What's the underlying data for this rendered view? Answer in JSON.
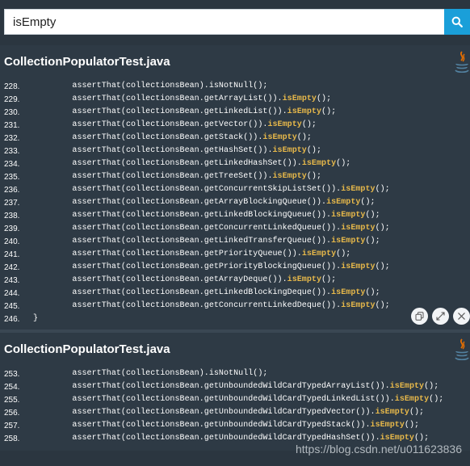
{
  "search": {
    "value": "isEmpty",
    "button_icon": "search-icon"
  },
  "results": [
    {
      "title": "CollectionPopulatorTest.java",
      "icon": "java-icon",
      "lines": [
        {
          "n": "228.",
          "pre": "        assertThat(collectionsBean).isNotNull();",
          "hl": "",
          "post": ""
        },
        {
          "n": "229.",
          "pre": "        assertThat(collectionsBean.getArrayList()).",
          "hl": "isEmpty",
          "post": "();"
        },
        {
          "n": "230.",
          "pre": "        assertThat(collectionsBean.getLinkedList()).",
          "hl": "isEmpty",
          "post": "();"
        },
        {
          "n": "231.",
          "pre": "        assertThat(collectionsBean.getVector()).",
          "hl": "isEmpty",
          "post": "();"
        },
        {
          "n": "232.",
          "pre": "        assertThat(collectionsBean.getStack()).",
          "hl": "isEmpty",
          "post": "();"
        },
        {
          "n": "233.",
          "pre": "        assertThat(collectionsBean.getHashSet()).",
          "hl": "isEmpty",
          "post": "();"
        },
        {
          "n": "234.",
          "pre": "        assertThat(collectionsBean.getLinkedHashSet()).",
          "hl": "isEmpty",
          "post": "();"
        },
        {
          "n": "235.",
          "pre": "        assertThat(collectionsBean.getTreeSet()).",
          "hl": "isEmpty",
          "post": "();"
        },
        {
          "n": "236.",
          "pre": "        assertThat(collectionsBean.getConcurrentSkipListSet()).",
          "hl": "isEmpty",
          "post": "();"
        },
        {
          "n": "237.",
          "pre": "        assertThat(collectionsBean.getArrayBlockingQueue()).",
          "hl": "isEmpty",
          "post": "();"
        },
        {
          "n": "238.",
          "pre": "        assertThat(collectionsBean.getLinkedBlockingQueue()).",
          "hl": "isEmpty",
          "post": "();"
        },
        {
          "n": "239.",
          "pre": "        assertThat(collectionsBean.getConcurrentLinkedQueue()).",
          "hl": "isEmpty",
          "post": "();"
        },
        {
          "n": "240.",
          "pre": "        assertThat(collectionsBean.getLinkedTransferQueue()).",
          "hl": "isEmpty",
          "post": "();"
        },
        {
          "n": "241.",
          "pre": "        assertThat(collectionsBean.getPriorityQueue()).",
          "hl": "isEmpty",
          "post": "();"
        },
        {
          "n": "242.",
          "pre": "        assertThat(collectionsBean.getPriorityBlockingQueue()).",
          "hl": "isEmpty",
          "post": "();"
        },
        {
          "n": "243.",
          "pre": "        assertThat(collectionsBean.getArrayDeque()).",
          "hl": "isEmpty",
          "post": "();"
        },
        {
          "n": "244.",
          "pre": "        assertThat(collectionsBean.getLinkedBlockingDeque()).",
          "hl": "isEmpty",
          "post": "();"
        },
        {
          "n": "245.",
          "pre": "        assertThat(collectionsBean.getConcurrentLinkedDeque()).",
          "hl": "isEmpty",
          "post": "();"
        },
        {
          "n": "246.",
          "pre": "}",
          "hl": "",
          "post": ""
        }
      ],
      "actions": [
        "copy-icon",
        "expand-icon",
        "close-icon"
      ]
    },
    {
      "title": "CollectionPopulatorTest.java",
      "icon": "java-icon",
      "lines": [
        {
          "n": "253.",
          "pre": "        assertThat(collectionsBean).isNotNull();",
          "hl": "",
          "post": ""
        },
        {
          "n": "254.",
          "pre": "        assertThat(collectionsBean.getUnboundedWildCardTypedArrayList()).",
          "hl": "isEmpty",
          "post": "();"
        },
        {
          "n": "255.",
          "pre": "        assertThat(collectionsBean.getUnboundedWildCardTypedLinkedList()).",
          "hl": "isEmpty",
          "post": "();"
        },
        {
          "n": "256.",
          "pre": "        assertThat(collectionsBean.getUnboundedWildCardTypedVector()).",
          "hl": "isEmpty",
          "post": "();"
        },
        {
          "n": "257.",
          "pre": "        assertThat(collectionsBean.getUnboundedWildCardTypedStack()).",
          "hl": "isEmpty",
          "post": "();"
        },
        {
          "n": "258.",
          "pre": "        assertThat(collectionsBean.getUnboundedWildCardTypedHashSet()).",
          "hl": "isEmpty",
          "post": "();"
        }
      ]
    }
  ],
  "watermark": "https://blog.csdn.net/u011623836",
  "colors": {
    "background": "#2e3a45",
    "highlight": "#e8b94a",
    "search_button": "#1a9fd9"
  }
}
